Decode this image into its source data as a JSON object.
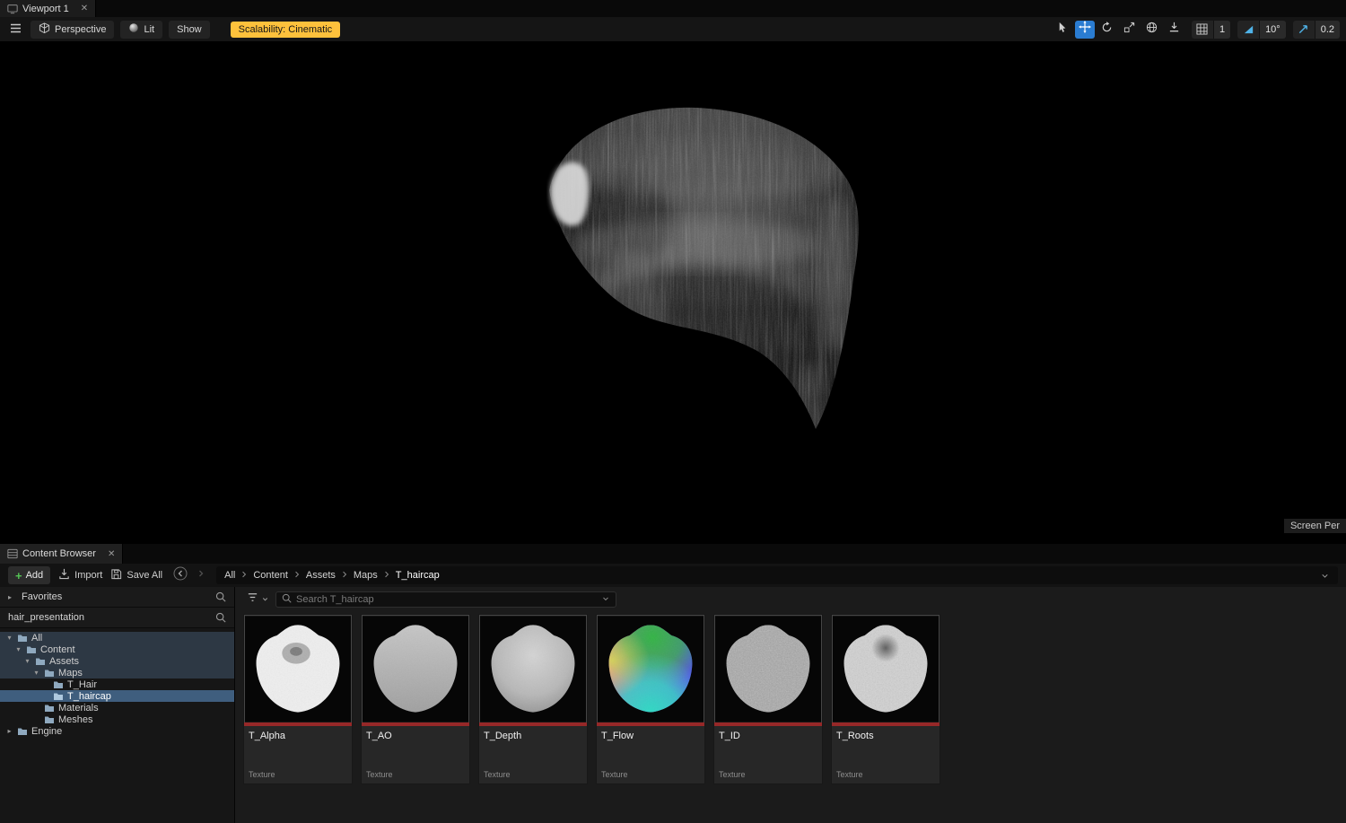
{
  "viewport": {
    "tab": {
      "title": "Viewport 1",
      "close_glyph": "✕"
    },
    "toolbar": {
      "perspective_label": "Perspective",
      "lit_label": "Lit",
      "show_label": "Show",
      "scalability_label": "Scalability: Cinematic",
      "grid_snap_value": "1",
      "rotation_snap_value": "10°",
      "scale_snap_value": "0.2"
    },
    "overlay": {
      "screen_percentage_label": "Screen Per"
    }
  },
  "content_browser": {
    "tab": {
      "title": "Content Browser",
      "close_glyph": "✕"
    },
    "toolbar": {
      "add_label": "Add",
      "import_label": "Import",
      "save_all_label": "Save All"
    },
    "breadcrumb": [
      "All",
      "Content",
      "Assets",
      "Maps",
      "T_haircap"
    ],
    "favorites": {
      "label": "Favorites",
      "arrow": "▸"
    },
    "collection": {
      "label": "hair_presentation"
    },
    "search": {
      "placeholder": "Search T_haircap"
    },
    "tree": [
      {
        "label": "All",
        "arrow": "▾"
      },
      {
        "label": "Content",
        "arrow": "▾"
      },
      {
        "label": "Assets",
        "arrow": "▾"
      },
      {
        "label": "Maps",
        "arrow": "▾"
      },
      {
        "label": "T_Hair",
        "arrow": ""
      },
      {
        "label": "T_haircap",
        "arrow": ""
      },
      {
        "label": "Materials",
        "arrow": ""
      },
      {
        "label": "Meshes",
        "arrow": ""
      },
      {
        "label": "Engine",
        "arrow": "▸"
      }
    ],
    "assets": [
      {
        "name": "T_Alpha",
        "type": "Texture"
      },
      {
        "name": "T_AO",
        "type": "Texture"
      },
      {
        "name": "T_Depth",
        "type": "Texture"
      },
      {
        "name": "T_Flow",
        "type": "Texture"
      },
      {
        "name": "T_ID",
        "type": "Texture"
      },
      {
        "name": "T_Roots",
        "type": "Texture"
      }
    ]
  },
  "colors": {
    "accent_blue": "#2a7cd1",
    "scalability_yellow": "#fdc13c",
    "texture_bar_red": "#962828",
    "selection_blue": "#3f5e7e"
  }
}
